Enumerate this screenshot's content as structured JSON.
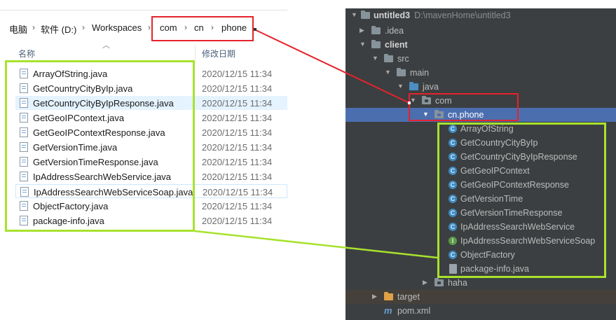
{
  "explorer": {
    "breadcrumb": [
      "电脑",
      "软件 (D:)",
      "Workspaces",
      "com",
      "cn",
      "phone"
    ],
    "column_name": "名称",
    "column_date": "修改日期",
    "files": [
      {
        "name": "ArrayOfString.java",
        "date": "2020/12/15 11:34"
      },
      {
        "name": "GetCountryCityByIp.java",
        "date": "2020/12/15 11:34"
      },
      {
        "name": "GetCountryCityByIpResponse.java",
        "date": "2020/12/15 11:34"
      },
      {
        "name": "GetGeoIPContext.java",
        "date": "2020/12/15 11:34"
      },
      {
        "name": "GetGeoIPContextResponse.java",
        "date": "2020/12/15 11:34"
      },
      {
        "name": "GetVersionTime.java",
        "date": "2020/12/15 11:34"
      },
      {
        "name": "GetVersionTimeResponse.java",
        "date": "2020/12/15 11:34"
      },
      {
        "name": "IpAddressSearchWebService.java",
        "date": "2020/12/15 11:34"
      },
      {
        "name": "IpAddressSearchWebServiceSoap.java",
        "date": "2020/12/15 11:34"
      },
      {
        "name": "ObjectFactory.java",
        "date": "2020/12/15 11:34"
      },
      {
        "name": "package-info.java",
        "date": "2020/12/15 11:34"
      }
    ]
  },
  "ide": {
    "root_name": "untitled3",
    "root_path": "D:\\mavenHome\\untitled3",
    "idea": ".idea",
    "client": "client",
    "src": "src",
    "main": "main",
    "java": "java",
    "com": "com",
    "cn_phone": "cn.phone",
    "classes": [
      "ArrayOfString",
      "GetCountryCityByIp",
      "GetCountryCityByIpResponse",
      "GetGeoIPContext",
      "GetGeoIPContextResponse",
      "GetVersionTime",
      "GetVersionTimeResponse",
      "IpAddressSearchWebService",
      "IpAddressSearchWebServiceSoap",
      "ObjectFactory"
    ],
    "package_info": "package-info.java",
    "haha": "haha",
    "target": "target",
    "pom": "pom.xml",
    "class_icon_letter": "C",
    "interface_icon_letter": "I"
  },
  "colors": {
    "annotation_red": "#e5232b",
    "annotation_green": "#a8e22e",
    "ide_background": "#3c3f41",
    "ide_selection": "#4b6eaf"
  }
}
